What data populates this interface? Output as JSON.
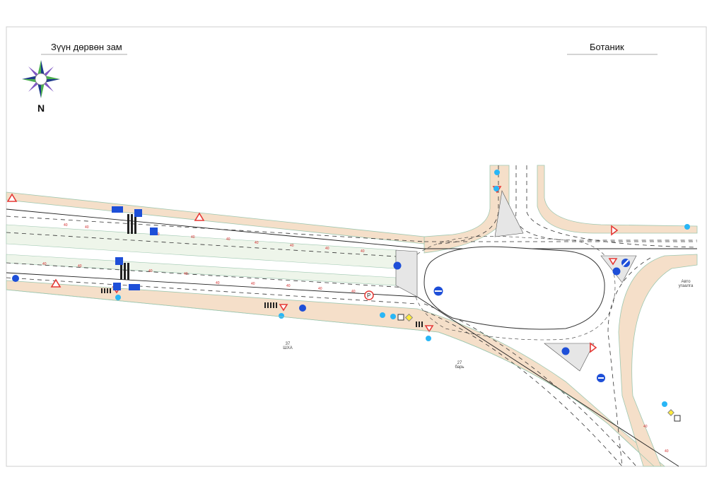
{
  "labels": {
    "west_direction": "Зүүн дөрвөн зам",
    "east_direction": "Ботаник",
    "north": "N",
    "auto_station": [
      "Авто",
      "угаалга"
    ],
    "zone_37": "37",
    "zone_37_sub": "ШХА",
    "zone_27": "27",
    "zone_27_sub": "барь"
  },
  "colors": {
    "road_surface": "#ffffff",
    "sidewalk": "#f5dfc9",
    "green_strip": "#eef5ea",
    "curb_line": "#9ec7b0",
    "lane_marking": "#333333",
    "speed_marking": "#d32f2f",
    "sign_blue": "#1e4fd8",
    "sign_red": "#e53935",
    "sign_cyan": "#29b6f6"
  },
  "icons": [
    "compass-rose-icon",
    "warning-triangle-sign-icon",
    "yield-sign-icon",
    "bus-stop-sign-icon",
    "pedestrian-crossing-sign-icon",
    "mandatory-direction-sign-icon",
    "no-entry-sign-icon",
    "no-parking-sign-icon"
  ]
}
